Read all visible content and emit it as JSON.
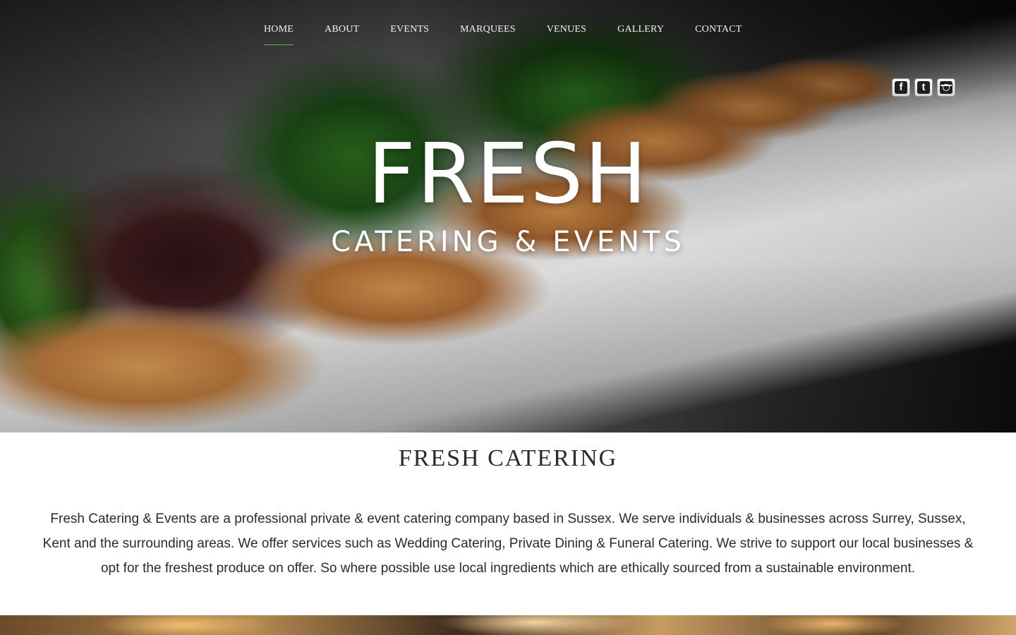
{
  "nav": {
    "items": [
      {
        "label": "HOME",
        "active": true
      },
      {
        "label": "ABOUT"
      },
      {
        "label": "EVENTS"
      },
      {
        "label": "MARQUEES"
      },
      {
        "label": "VENUES"
      },
      {
        "label": "GALLERY"
      },
      {
        "label": "CONTACT"
      }
    ]
  },
  "social": {
    "facebook_glyph": "f",
    "twitter_glyph": "t",
    "icons": [
      "facebook-icon",
      "twitter-icon",
      "instagram-icon"
    ]
  },
  "hero": {
    "logo_main": "FRESH",
    "logo_sub": "CATERING & EVENTS"
  },
  "main": {
    "title": "FRESH CATERING",
    "intro": "Fresh Catering & Events are a professional private & event catering company based in Sussex. We serve individuals & businesses across Surrey, Sussex, Kent and the surrounding areas. We offer services such as Wedding Catering, Private Dining & Funeral Catering. We strive to support our local businesses & opt for the freshest produce on offer. So where possible  use local ingredients which are ethically sourced from a sustainable environment."
  },
  "colors": {
    "nav_active_underline": "#5fb05a",
    "text_dark": "#2b2b2b"
  }
}
